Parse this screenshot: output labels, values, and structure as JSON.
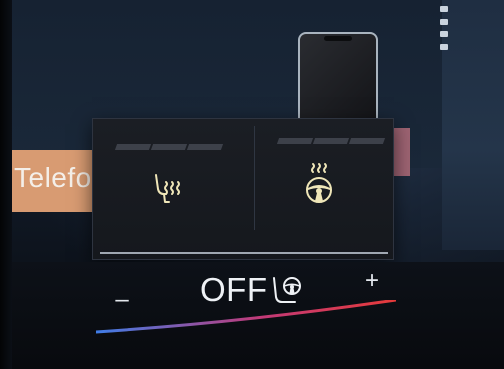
{
  "screen": {
    "tile_label": "Telefon",
    "seat_heating": {
      "level": 0,
      "max_level": 3,
      "icon": "seat-heat-icon",
      "active_color": "#efe6b8"
    },
    "wheel_heating": {
      "level": 0,
      "max_level": 3,
      "icon": "steering-wheel-heat-icon",
      "active_color": "#efe6b8"
    }
  },
  "climate_bar": {
    "minus_label": "–",
    "plus_label": "+",
    "status": "OFF",
    "status_icon": "seat-steering-wheel-icon",
    "gradient_colors": [
      "#3f7de8",
      "#c23a78",
      "#e63a3a"
    ]
  },
  "indicator_color": "#3d414a"
}
